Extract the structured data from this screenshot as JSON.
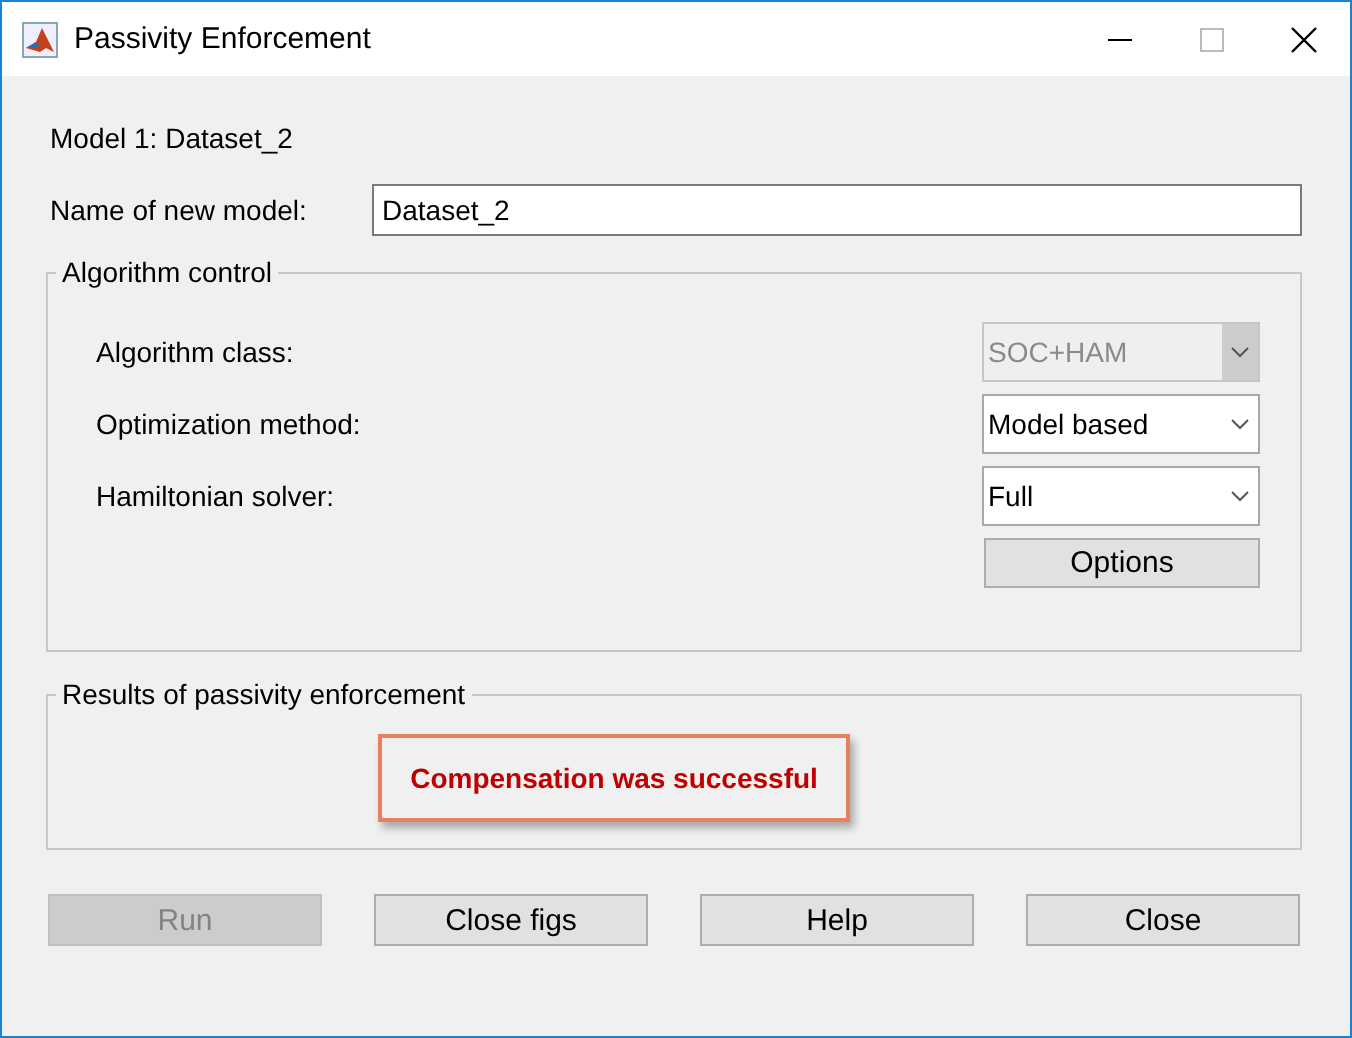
{
  "window": {
    "title": "Passivity Enforcement"
  },
  "model_label": "Model 1: Dataset_2",
  "name_field": {
    "label": "Name of new model:",
    "value": "Dataset_2"
  },
  "algorithm_control": {
    "title": "Algorithm control",
    "settings": [
      {
        "kind": "dropdown",
        "label": "Algorithm class:",
        "value": "SOC+HAM",
        "disabled": true
      },
      {
        "kind": "dropdown",
        "label": "Optimization method:",
        "value": "Model based",
        "disabled": false
      },
      {
        "kind": "dropdown",
        "label": "Hamiltonian solver:",
        "value": "Full",
        "disabled": false
      }
    ],
    "options_button": "Options"
  },
  "results": {
    "title": "Results of passivity enforcement",
    "message": "Compensation was successful",
    "highlighted": true
  },
  "buttons": [
    {
      "label": "Run",
      "disabled": true
    },
    {
      "label": "Close figs",
      "disabled": false
    },
    {
      "label": "Help",
      "disabled": false
    },
    {
      "label": "Close",
      "disabled": false
    }
  ]
}
